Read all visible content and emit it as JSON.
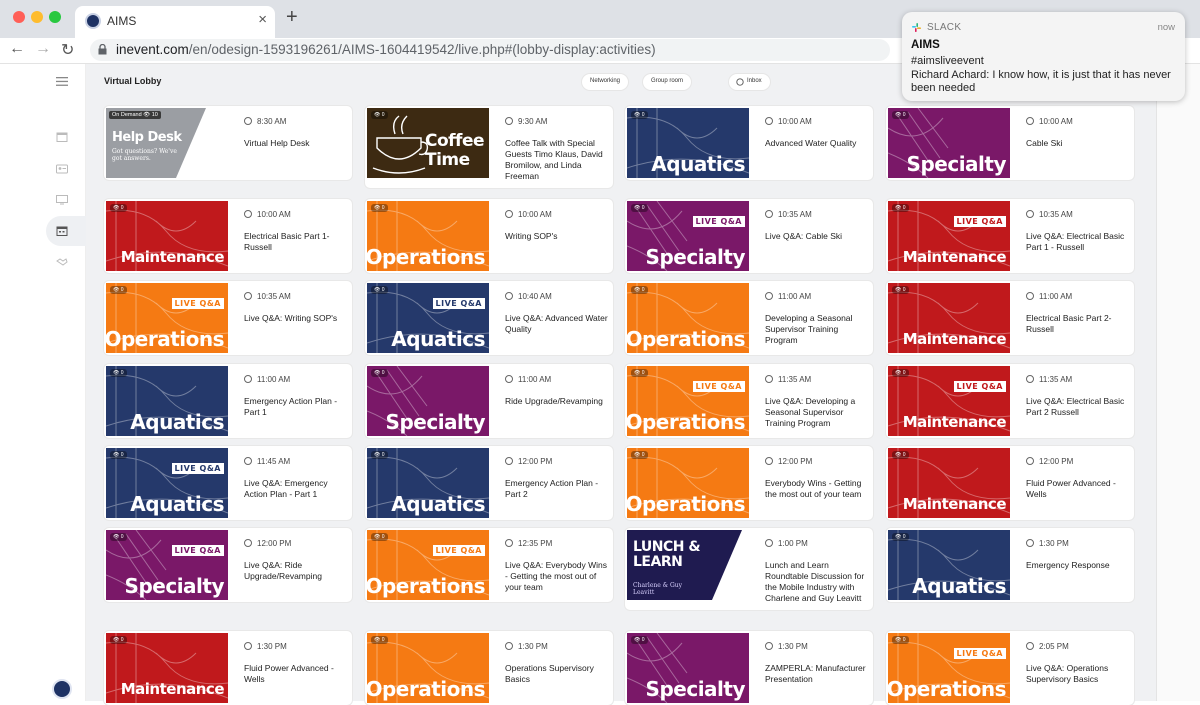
{
  "browser": {
    "tab_title": "AIMS",
    "tab_close": "×",
    "new_tab": "+",
    "url_host": "inevent.com",
    "url_path": "/en/odesign-1593196261/AIMS-1604419542/live.php#(lobby-display:activities)",
    "back": "←",
    "forward": "→",
    "reload": "↻",
    "traffic_lights": [
      "#ff5f57",
      "#febc2e",
      "#28c840"
    ]
  },
  "header": {
    "title": "Virtual Lobby",
    "pills": [
      "Networking",
      "Group room",
      "Inbox"
    ]
  },
  "colors": {
    "aquatics": "#25396b",
    "maintenance": "#c0191c",
    "operations": "#f57a13",
    "specialty": "#7a1868",
    "helpdesk": "#9b9ea3",
    "coffee": "#3d2a12",
    "lunch": "#1f1b50"
  },
  "cards": [
    {
      "time": "8:30 AM",
      "name": "Virtual Help Desk",
      "theme": "helpdesk",
      "title": "Help Desk",
      "badge": "On Demand   👁 10",
      "extra": "Got questions? We've got answers."
    },
    {
      "time": "9:30 AM",
      "name": "Coffee Talk with Special Guests Timo Klaus, David Bromilow, and Linda Freeman",
      "theme": "coffee",
      "title": "Coffee Time",
      "badge": "👁 0"
    },
    {
      "time": "10:00 AM",
      "name": "Advanced Water Quality",
      "theme": "aquatics",
      "title": "Aquatics",
      "badge": "👁 0"
    },
    {
      "time": "10:00 AM",
      "name": "Cable Ski",
      "theme": "specialty",
      "title": "Specialty",
      "badge": "👁 0"
    },
    {
      "time": "10:00 AM",
      "name": "Electrical Basic Part 1- Russell",
      "theme": "maintenance",
      "title": "Maintenance",
      "badge": "👁 0"
    },
    {
      "time": "10:00 AM",
      "name": "Writing SOP's",
      "theme": "operations",
      "title": "Operations",
      "badge": "👁 0"
    },
    {
      "time": "10:35 AM",
      "name": "Live Q&A: Cable Ski",
      "theme": "specialty",
      "title": "Specialty",
      "live": "LIVE Q&A",
      "badge": "👁 0"
    },
    {
      "time": "10:35 AM",
      "name": "Live Q&A: Electrical Basic Part 1 - Russell",
      "theme": "maintenance",
      "title": "Maintenance",
      "live": "LIVE Q&A",
      "badge": "👁 0"
    },
    {
      "time": "10:35 AM",
      "name": "Live Q&A: Writing SOP's",
      "theme": "operations",
      "title": "Operations",
      "live": "LIVE Q&A",
      "badge": "👁 0"
    },
    {
      "time": "10:40 AM",
      "name": "Live Q&A: Advanced Water Quality",
      "theme": "aquatics",
      "title": "Aquatics",
      "live": "LIVE Q&A",
      "badge": "👁 0"
    },
    {
      "time": "11:00 AM",
      "name": "Developing a Seasonal Supervisor Training Program",
      "theme": "operations",
      "title": "Operations",
      "badge": "👁 0"
    },
    {
      "time": "11:00 AM",
      "name": "Electrical Basic Part 2- Russell",
      "theme": "maintenance",
      "title": "Maintenance",
      "badge": "👁 0"
    },
    {
      "time": "11:00 AM",
      "name": "Emergency Action Plan - Part 1",
      "theme": "aquatics",
      "title": "Aquatics",
      "badge": "👁 0"
    },
    {
      "time": "11:00 AM",
      "name": "Ride Upgrade/Revamping",
      "theme": "specialty",
      "title": "Specialty",
      "badge": "👁 0"
    },
    {
      "time": "11:35 AM",
      "name": "Live Q&A: Developing a Seasonal Supervisor Training Program",
      "theme": "operations",
      "title": "Operations",
      "live": "LIVE Q&A",
      "badge": "👁 0"
    },
    {
      "time": "11:35 AM",
      "name": "Live Q&A: Electrical Basic Part 2 Russell",
      "theme": "maintenance",
      "title": "Maintenance",
      "live": "LIVE Q&A",
      "badge": "👁 0"
    },
    {
      "time": "11:45 AM",
      "name": "Live Q&A: Emergency Action Plan - Part 1",
      "theme": "aquatics",
      "title": "Aquatics",
      "live": "LIVE Q&A",
      "badge": "👁 0"
    },
    {
      "time": "12:00 PM",
      "name": "Emergency Action Plan - Part 2",
      "theme": "aquatics",
      "title": "Aquatics",
      "badge": "👁 0"
    },
    {
      "time": "12:00 PM",
      "name": "Everybody Wins - Getting the most out of your team",
      "theme": "operations",
      "title": "Operations",
      "badge": "👁 0"
    },
    {
      "time": "12:00 PM",
      "name": "Fluid Power Advanced - Wells",
      "theme": "maintenance",
      "title": "Maintenance",
      "badge": "👁 0"
    },
    {
      "time": "12:00 PM",
      "name": "Live Q&A: Ride Upgrade/Revamping",
      "theme": "specialty",
      "title": "Specialty",
      "live": "LIVE Q&A",
      "badge": "👁 0"
    },
    {
      "time": "12:35 PM",
      "name": "Live Q&A: Everybody Wins - Getting the most out of your team",
      "theme": "operations",
      "title": "Operations",
      "live": "LIVE Q&A",
      "badge": "👁 0"
    },
    {
      "time": "1:00 PM",
      "name": "Lunch and Learn Roundtable Discussion for the Mobile Industry with Charlene and Guy Leavitt",
      "theme": "lunch",
      "title": "LUNCH & LEARN",
      "extra": "Charlene & Guy Leavitt"
    },
    {
      "time": "1:30 PM",
      "name": "Emergency Response",
      "theme": "aquatics",
      "title": "Aquatics",
      "badge": "👁 0"
    },
    {
      "time": "1:30 PM",
      "name": "Fluid Power Advanced - Wells",
      "theme": "maintenance",
      "title": "Maintenance",
      "badge": "👁 0"
    },
    {
      "time": "1:30 PM",
      "name": "Operations Supervisory Basics",
      "theme": "operations",
      "title": "Operations",
      "badge": "👁 0"
    },
    {
      "time": "1:30 PM",
      "name": "ZAMPERLA: Manufacturer Presentation",
      "theme": "specialty",
      "title": "Specialty",
      "badge": "👁 0"
    },
    {
      "time": "2:05 PM",
      "name": "Live Q&A: Operations Supervisory Basics",
      "theme": "operations",
      "title": "Operations",
      "live": "LIVE Q&A",
      "badge": "👁 0"
    }
  ],
  "notification": {
    "app": "SLACK",
    "time": "now",
    "title": "AIMS",
    "channel": "#aimsliveevent",
    "message": "Richard Achard: I know how, it is just that it has never been needed"
  }
}
